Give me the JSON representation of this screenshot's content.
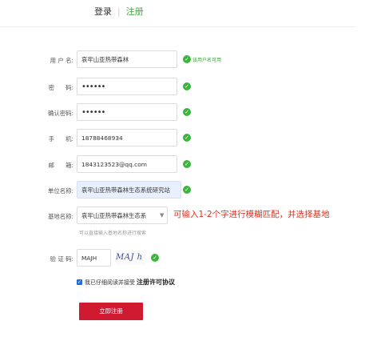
{
  "tabs": {
    "login": "登录",
    "separator": "|",
    "register": "注册"
  },
  "form": {
    "username": {
      "label": "用 户 名:",
      "value": "哀牢山亚热带森林",
      "hint": "该用户名可用"
    },
    "password": {
      "label": "密      码:",
      "value": "••••••"
    },
    "confirm_password": {
      "label": "确认密码:",
      "value": "••••••"
    },
    "phone": {
      "label": "手      机:",
      "value": "18788468934"
    },
    "email": {
      "label": "邮      箱:",
      "value": "1843123523@qq.com"
    },
    "unit": {
      "label": "单位名称:",
      "value": "哀牢山亚热带森林生态系统研究站"
    },
    "base": {
      "label": "基地名称:",
      "selected": "哀牢山亚热带森林生态系",
      "hint": "可以直接输入基地名称进行搜索",
      "annotation": "可输入1-2个字进行模糊匹配，并选择基地"
    },
    "captcha": {
      "label": "验 证 码:",
      "value": "MAJH",
      "image_text": "MAJ h"
    },
    "agree": {
      "text": "我已仔细阅读并接受",
      "link": "注册许可协议",
      "checked": true
    },
    "submit_label": "立即注册"
  },
  "icons": {
    "check": "check-circle-icon",
    "dropdown": "chevron-down-icon",
    "checkbox": "checkbox-checked-icon"
  },
  "colors": {
    "accent_green": "#3aa53a",
    "submit_red": "#d01a31",
    "annotation_red": "#e0301e",
    "checkbox_blue": "#1e6fd9"
  }
}
